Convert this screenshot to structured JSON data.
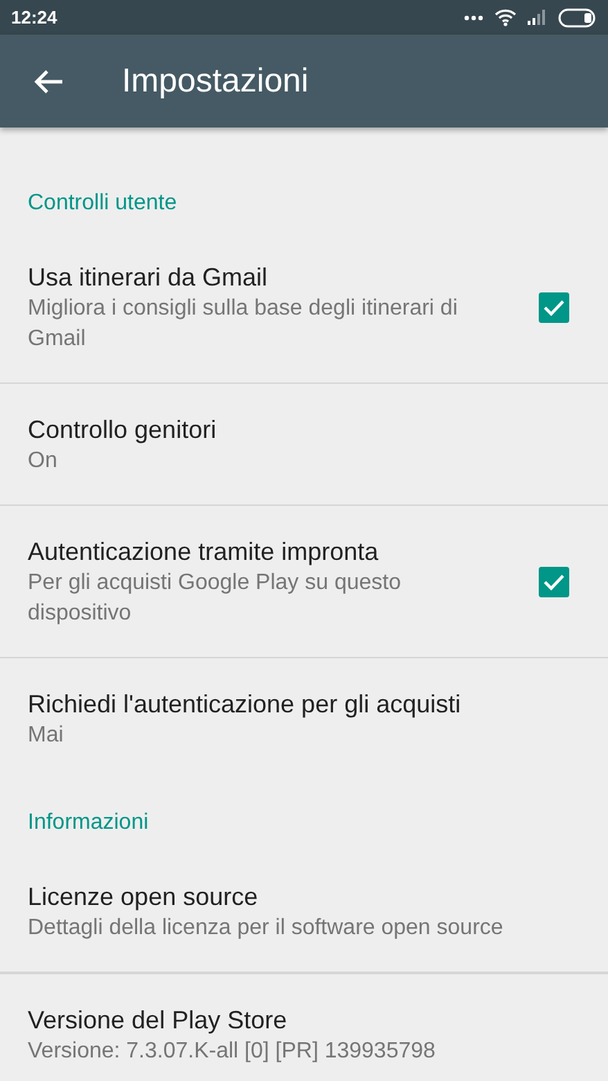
{
  "status_bar": {
    "time": "12:24"
  },
  "app_bar": {
    "title": "Impostazioni"
  },
  "sections": [
    {
      "header": "Controlli utente",
      "items": [
        {
          "kind": "checkbox",
          "title": "Usa itinerari da Gmail",
          "subtitle": "Migliora i consigli sulla base degli itinerari di Gmail",
          "checked": true
        },
        {
          "kind": "plain",
          "title": "Controllo genitori",
          "subtitle": "On"
        },
        {
          "kind": "checkbox",
          "title": "Autenticazione tramite impronta",
          "subtitle": "Per gli acquisti Google Play su questo dispositivo",
          "checked": true
        },
        {
          "kind": "plain",
          "title": "Richiedi l'autenticazione per gli acquisti",
          "subtitle": "Mai"
        }
      ]
    },
    {
      "header": "Informazioni",
      "items": [
        {
          "kind": "plain",
          "title": "Licenze open source",
          "subtitle": "Dettagli della licenza per il software open source"
        },
        {
          "kind": "plain",
          "title": "Versione del Play Store",
          "subtitle": "Versione: 7.3.07.K-all [0] [PR] 139935798"
        }
      ]
    }
  ]
}
